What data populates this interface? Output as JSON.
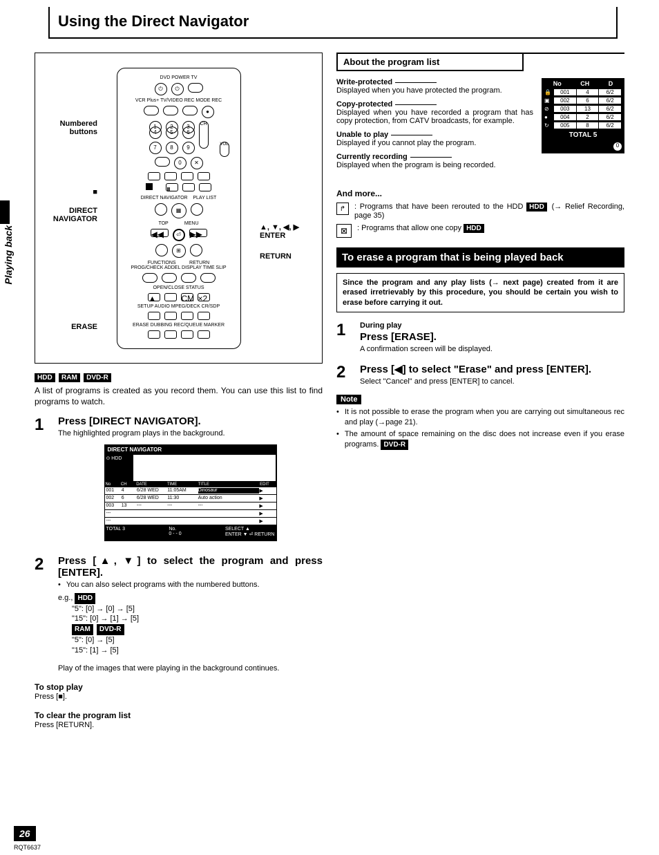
{
  "sideTab": "Playing back",
  "title": "Using the Direct Navigator",
  "remote": {
    "callouts": {
      "numbered": "Numbered buttons",
      "stop": "■",
      "directNav": "DIRECT NAVIGATOR",
      "erase": "ERASE",
      "arrows": "▲, ▼, ◀, ▶ ENTER",
      "return": "RETURN"
    }
  },
  "badges": {
    "hdd": "HDD",
    "ram": "RAM",
    "dvdr": "DVD-R"
  },
  "leftIntro": "A list of programs is created as you record them. You can use this list to find programs to watch.",
  "leftSteps": [
    {
      "num": "1",
      "title": "Press [DIRECT NAVIGATOR].",
      "sub": "The highlighted program plays in the background."
    },
    {
      "num": "2",
      "title": "Press [▲, ▼] to select the program and press [ENTER].",
      "bullets": [
        "You can also select programs with the numbered buttons."
      ],
      "eg": "e.g.,",
      "lines": [
        "\"5\": [0] → [0] → [5]",
        "\"15\": [0] → [1] → [5]",
        "",
        "\"5\": [0] → [5]",
        "\"15\": [1] → [5]"
      ],
      "post": "Play of the images that were playing in the background continues."
    }
  ],
  "screenLabel1": "DIRECT NAVIGATOR",
  "toStop": {
    "head": "To stop play",
    "body": "Press [■]."
  },
  "toClear": {
    "head": "To clear the program list",
    "body": "Press [RETURN]."
  },
  "aboutHeader": "About the program list",
  "defs": [
    {
      "term": "Write-protected",
      "body": "Displayed when you have protected the program."
    },
    {
      "term": "Copy-protected",
      "body": "Displayed when you have recorded a program that has copy protection, from CATV broadcasts, for example."
    },
    {
      "term": "Unable to play",
      "body": "Displayed if you cannot play the program."
    },
    {
      "term": "Currently recording",
      "body": "Displayed when the program is being recorded."
    }
  ],
  "miniScreen": {
    "headers": [
      "No",
      "CH",
      "D"
    ],
    "rows": [
      [
        "001",
        "4",
        "6/2"
      ],
      [
        "002",
        "6",
        "6/2"
      ],
      [
        "003",
        "13",
        "6/2"
      ],
      [
        "004",
        "2",
        "6/2"
      ],
      [
        "005",
        "8",
        "6/2"
      ]
    ],
    "footer": "TOTAL 5"
  },
  "andMore": {
    "head": "And more...",
    "items": [
      ": Programs that have been rerouted to the HDD HDD (→ Relief Recording, page 35)",
      ": Programs that allow one copy HDD"
    ]
  },
  "eraseHeader": "To erase a program that is being played back",
  "eraseWarning": "Since the program and any play lists (→ next page) created from it are erased irretrievably by this procedure, you should be certain you wish to erase before carrying it out.",
  "eraseSteps": [
    {
      "num": "1",
      "pre": "During play",
      "title": "Press [ERASE].",
      "sub": "A confirmation screen will be displayed."
    },
    {
      "num": "2",
      "title": "Press [◀] to select \"Erase\" and press [ENTER].",
      "sub": "Select \"Cancel\" and press [ENTER] to cancel."
    }
  ],
  "note": "Note",
  "noteItems": [
    "It is not possible to erase the program when you are carrying out simultaneous rec and play (→page 21).",
    "The amount of space remaining on the disc does not increase even if you erase programs. DVD-R"
  ],
  "pageNum": "26",
  "pageCode": "RQT6637"
}
